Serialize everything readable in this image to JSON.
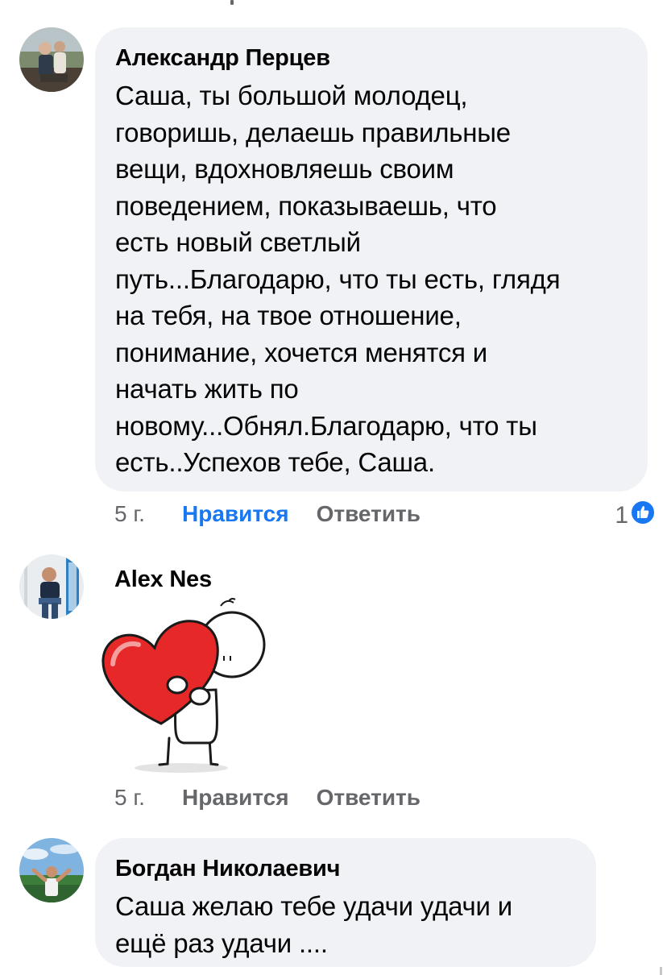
{
  "comments": [
    {
      "author": "Александр Перцев",
      "lines": [
        "Саша, ты большой молодец,",
        "говоришь, делаешь правильные",
        "вещи, вдохновляешь своим",
        "поведением, показываешь, что",
        "есть новый светлый",
        "путь...Благодарю, что ты есть, глядя",
        "на тебя, на твое отношение,",
        "понимание, хочется менятся и",
        "начать жить по",
        "новому...Обнял.Благодарю, что ты",
        "есть..Успехов тебе, Саша."
      ],
      "time": "5 г.",
      "like_label": "Нравится",
      "like_active": true,
      "reply_label": "Ответить",
      "reaction_count": "1",
      "reaction_icon": "like-thumb-icon"
    },
    {
      "author": "Alex Nes",
      "sticker": "heart-hug-sticker",
      "time": "5 г.",
      "like_label": "Нравится",
      "like_active": false,
      "reply_label": "Ответить"
    },
    {
      "author": "Богдан Николаевич",
      "lines": [
        "Саша желаю тебе удачи удачи и",
        "ещё раз удачи ...."
      ]
    }
  ],
  "colors": {
    "bubble": "#f0f2f5",
    "text": "#050505",
    "meta": "#65676b",
    "accent": "#1877f2"
  }
}
